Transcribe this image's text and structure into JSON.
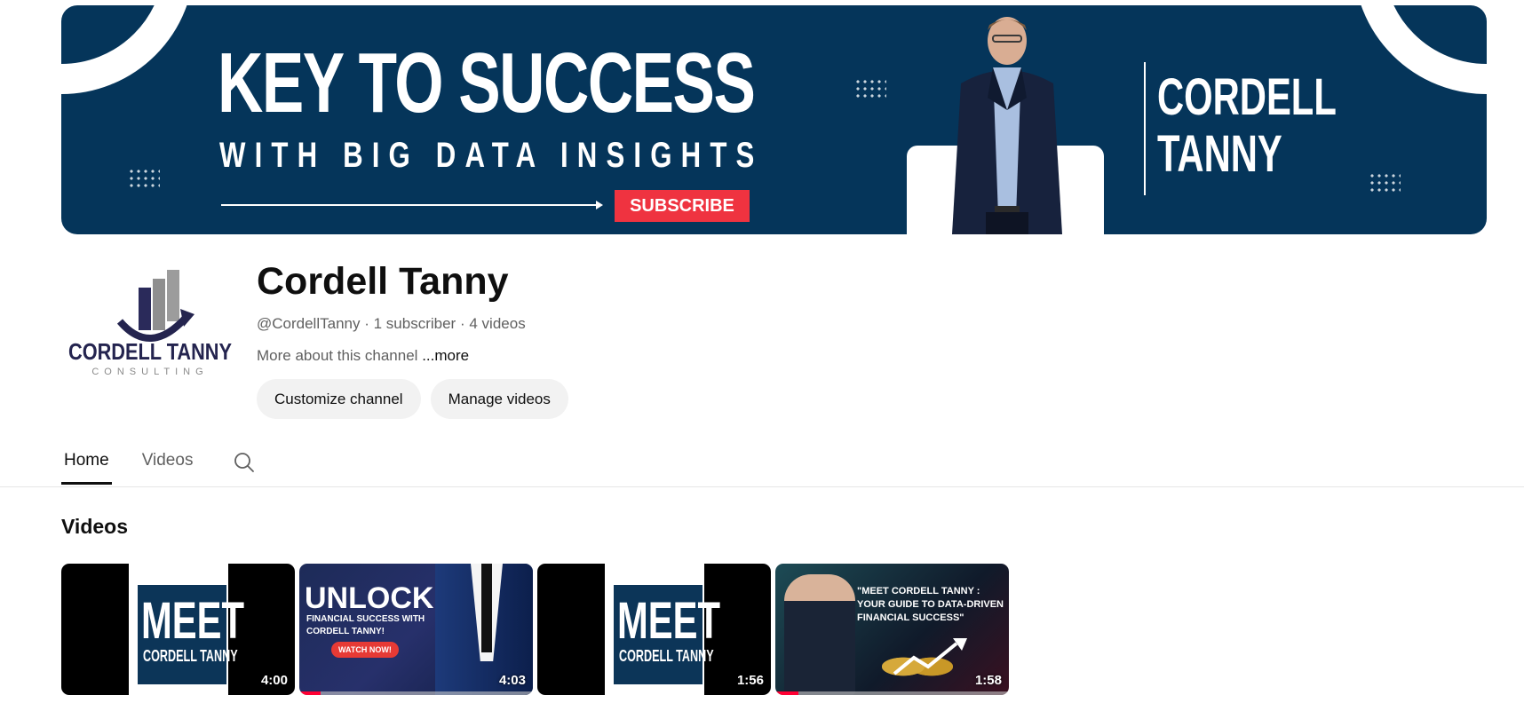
{
  "banner": {
    "headline": "KEY TO SUCCESS",
    "subheadline": "WITH BIG DATA INSIGHTS",
    "subscribe_label": "SUBSCRIBE",
    "name_line1": "CORDELL",
    "name_line2": "TANNY",
    "background_color": "#05355a",
    "accent_color": "#ef3340"
  },
  "channel": {
    "avatar_line1": "CORDELL TANNY",
    "avatar_line2": "CONSULTING",
    "title": "Cordell Tanny",
    "handle": "@CordellTanny",
    "subscribers": "1 subscriber",
    "video_count": "4 videos",
    "separator": "·",
    "about_text": "More about this channel",
    "about_more": "...more",
    "buttons": {
      "customize": "Customize channel",
      "manage": "Manage videos"
    }
  },
  "tabs": [
    {
      "label": "Home",
      "active": true
    },
    {
      "label": "Videos",
      "active": false
    }
  ],
  "section": {
    "title": "Videos"
  },
  "videos": [
    {
      "thumb_title": "MEET",
      "thumb_subtitle": "CORDELL TANNY",
      "duration": "4:00",
      "progress_fraction": 0
    },
    {
      "thumb_title": "UNLOCK",
      "thumb_subtitle": "FINANCIAL SUCCESS WITH CORDELL TANNY!",
      "thumb_cta": "WATCH NOW!",
      "duration": "4:03",
      "progress_fraction": 0.09
    },
    {
      "thumb_title": "MEET",
      "thumb_subtitle": "CORDELL TANNY",
      "duration": "1:56",
      "progress_fraction": 0
    },
    {
      "thumb_title": "\"MEET CORDELL TANNY : YOUR GUIDE TO DATA-DRIVEN FINANCIAL SUCCESS\"",
      "duration": "1:58",
      "progress_fraction": 0.1
    }
  ]
}
